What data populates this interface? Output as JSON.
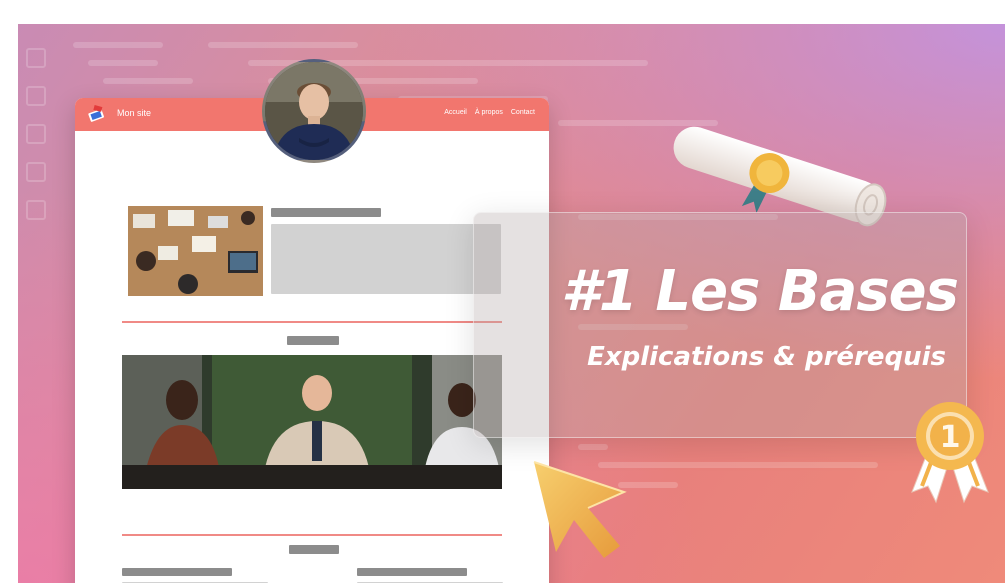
{
  "site": {
    "name": "Mon site",
    "nav": [
      "Accueil",
      "À propos",
      "Contact"
    ]
  },
  "headline": {
    "title": "#1 Les Bases",
    "subtitle": "Explications & prérequis"
  },
  "medal_number": "1",
  "colors": {
    "site_header": "#f2766e",
    "divider": "#f08a86",
    "medal": "#f2b24a",
    "cursor": "#f3b552"
  },
  "icons": [
    "diploma-icon",
    "medal-icon",
    "cursor-icon",
    "site-logo-icon"
  ]
}
